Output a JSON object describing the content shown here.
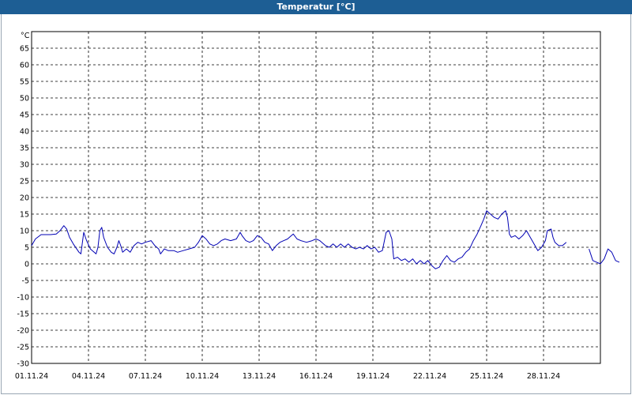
{
  "window": {
    "title": "Temperatur [°C]"
  },
  "chart_data": {
    "type": "line",
    "title": "Temperatur [°C]",
    "y_unit": "°C",
    "ylim": [
      -30,
      70
    ],
    "y_ticks": [
      65,
      60,
      55,
      50,
      45,
      40,
      35,
      30,
      25,
      20,
      15,
      10,
      5,
      0,
      -5,
      -10,
      -15,
      -20,
      -25,
      -30
    ],
    "x_ticks": [
      "01.11.24",
      "04.11.24",
      "07.11.24",
      "10.11.24",
      "13.11.24",
      "16.11.24",
      "19.11.24",
      "22.11.24",
      "25.11.24",
      "28.11.24"
    ],
    "x_range_days": [
      1,
      31
    ],
    "grid": true,
    "line_color": "#0000b4",
    "series": [
      {
        "segments": [
          [
            [
              1.0,
              5.5
            ],
            [
              1.2,
              7.5
            ],
            [
              1.5,
              8.8
            ],
            [
              2.0,
              8.8
            ],
            [
              2.3,
              9.0
            ],
            [
              2.5,
              10.0
            ],
            [
              2.7,
              11.5
            ],
            [
              2.85,
              10.5
            ],
            [
              3.0,
              8.0
            ],
            [
              3.2,
              6.0
            ],
            [
              3.5,
              3.5
            ],
            [
              3.6,
              3.0
            ],
            [
              3.75,
              9.5
            ],
            [
              3.9,
              7.0
            ],
            [
              4.1,
              4.5
            ],
            [
              4.3,
              3.5
            ],
            [
              4.4,
              3.0
            ],
            [
              4.5,
              5.0
            ],
            [
              4.6,
              10.0
            ],
            [
              4.7,
              11.0
            ],
            [
              4.8,
              8.0
            ],
            [
              5.0,
              5.0
            ],
            [
              5.2,
              3.5
            ],
            [
              5.35,
              3.0
            ],
            [
              5.5,
              5.0
            ],
            [
              5.6,
              7.0
            ],
            [
              5.7,
              5.5
            ],
            [
              5.8,
              3.5
            ],
            [
              6.0,
              4.5
            ],
            [
              6.2,
              3.5
            ],
            [
              6.4,
              5.5
            ],
            [
              6.6,
              6.5
            ],
            [
              6.8,
              6.0
            ],
            [
              7.0,
              6.5
            ],
            [
              7.3,
              7.0
            ],
            [
              7.5,
              5.5
            ],
            [
              7.7,
              4.5
            ],
            [
              7.8,
              3.0
            ],
            [
              8.0,
              4.5
            ],
            [
              8.2,
              4.0
            ],
            [
              8.5,
              4.0
            ],
            [
              8.7,
              3.5
            ],
            [
              9.0,
              4.0
            ],
            [
              9.3,
              4.5
            ],
            [
              9.6,
              5.0
            ],
            [
              9.8,
              6.5
            ],
            [
              10.0,
              8.5
            ],
            [
              10.2,
              7.5
            ],
            [
              10.4,
              6.0
            ],
            [
              10.6,
              5.5
            ],
            [
              10.8,
              6.0
            ],
            [
              11.0,
              7.0
            ],
            [
              11.2,
              7.5
            ],
            [
              11.5,
              7.0
            ],
            [
              11.8,
              7.5
            ],
            [
              12.0,
              9.5
            ],
            [
              12.1,
              8.5
            ],
            [
              12.3,
              7.0
            ],
            [
              12.5,
              6.5
            ],
            [
              12.7,
              7.0
            ],
            [
              12.9,
              8.5
            ],
            [
              13.1,
              8.0
            ],
            [
              13.3,
              6.5
            ],
            [
              13.5,
              6.0
            ],
            [
              13.7,
              4.0
            ],
            [
              13.9,
              5.5
            ],
            [
              14.1,
              6.5
            ],
            [
              14.3,
              7.0
            ],
            [
              14.5,
              7.5
            ],
            [
              14.7,
              8.5
            ],
            [
              14.8,
              9.0
            ],
            [
              15.0,
              7.5
            ],
            [
              15.2,
              7.0
            ],
            [
              15.5,
              6.5
            ],
            [
              15.8,
              7.0
            ],
            [
              16.0,
              7.5
            ],
            [
              16.2,
              7.0
            ],
            [
              16.5,
              5.5
            ],
            [
              16.7,
              5.0
            ],
            [
              16.9,
              6.0
            ],
            [
              17.1,
              5.0
            ],
            [
              17.3,
              6.0
            ],
            [
              17.5,
              5.0
            ],
            [
              17.7,
              6.0
            ],
            [
              17.9,
              5.0
            ],
            [
              18.1,
              4.5
            ],
            [
              18.3,
              5.0
            ],
            [
              18.5,
              4.5
            ],
            [
              18.7,
              5.5
            ],
            [
              18.9,
              4.5
            ],
            [
              19.1,
              5.0
            ],
            [
              19.3,
              3.5
            ],
            [
              19.5,
              4.0
            ],
            [
              19.7,
              9.5
            ],
            [
              19.85,
              10.0
            ],
            [
              20.0,
              7.5
            ],
            [
              20.1,
              1.5
            ],
            [
              20.3,
              2.0
            ],
            [
              20.5,
              1.0
            ],
            [
              20.7,
              1.5
            ],
            [
              20.9,
              0.5
            ],
            [
              21.1,
              1.5
            ],
            [
              21.3,
              0.0
            ],
            [
              21.5,
              1.0
            ],
            [
              21.7,
              0.0
            ],
            [
              21.9,
              1.0
            ],
            [
              22.1,
              -0.5
            ],
            [
              22.3,
              -1.5
            ],
            [
              22.5,
              -1.0
            ],
            [
              22.7,
              1.0
            ],
            [
              22.9,
              2.5
            ],
            [
              23.1,
              1.0
            ],
            [
              23.3,
              0.5
            ],
            [
              23.5,
              1.5
            ],
            [
              23.7,
              2.0
            ],
            [
              23.9,
              3.5
            ],
            [
              24.1,
              4.5
            ],
            [
              24.3,
              7.0
            ],
            [
              24.5,
              9.0
            ],
            [
              24.7,
              11.5
            ],
            [
              24.85,
              13.5
            ],
            [
              25.0,
              16.0
            ],
            [
              25.2,
              15.0
            ],
            [
              25.4,
              14.0
            ],
            [
              25.6,
              13.5
            ],
            [
              25.8,
              15.0
            ],
            [
              26.0,
              16.0
            ],
            [
              26.1,
              14.0
            ],
            [
              26.2,
              9.0
            ],
            [
              26.3,
              8.0
            ],
            [
              26.5,
              8.5
            ],
            [
              26.7,
              7.5
            ],
            [
              26.9,
              8.5
            ],
            [
              27.1,
              10.0
            ],
            [
              27.3,
              8.0
            ],
            [
              27.5,
              6.0
            ],
            [
              27.7,
              4.0
            ],
            [
              27.9,
              5.0
            ],
            [
              28.1,
              7.0
            ],
            [
              28.2,
              10.0
            ],
            [
              28.4,
              10.5
            ],
            [
              28.5,
              8.0
            ],
            [
              28.6,
              6.5
            ],
            [
              28.8,
              5.5
            ],
            [
              29.0,
              5.5
            ],
            [
              29.2,
              6.5
            ]
          ],
          [
            [
              30.4,
              4.5
            ],
            [
              30.6,
              1.0
            ],
            [
              30.8,
              0.5
            ],
            [
              31.0,
              0.0
            ],
            [
              31.2,
              1.5
            ],
            [
              31.4,
              4.5
            ],
            [
              31.6,
              3.5
            ],
            [
              31.8,
              1.0
            ],
            [
              32.0,
              0.5
            ]
          ]
        ]
      }
    ]
  }
}
